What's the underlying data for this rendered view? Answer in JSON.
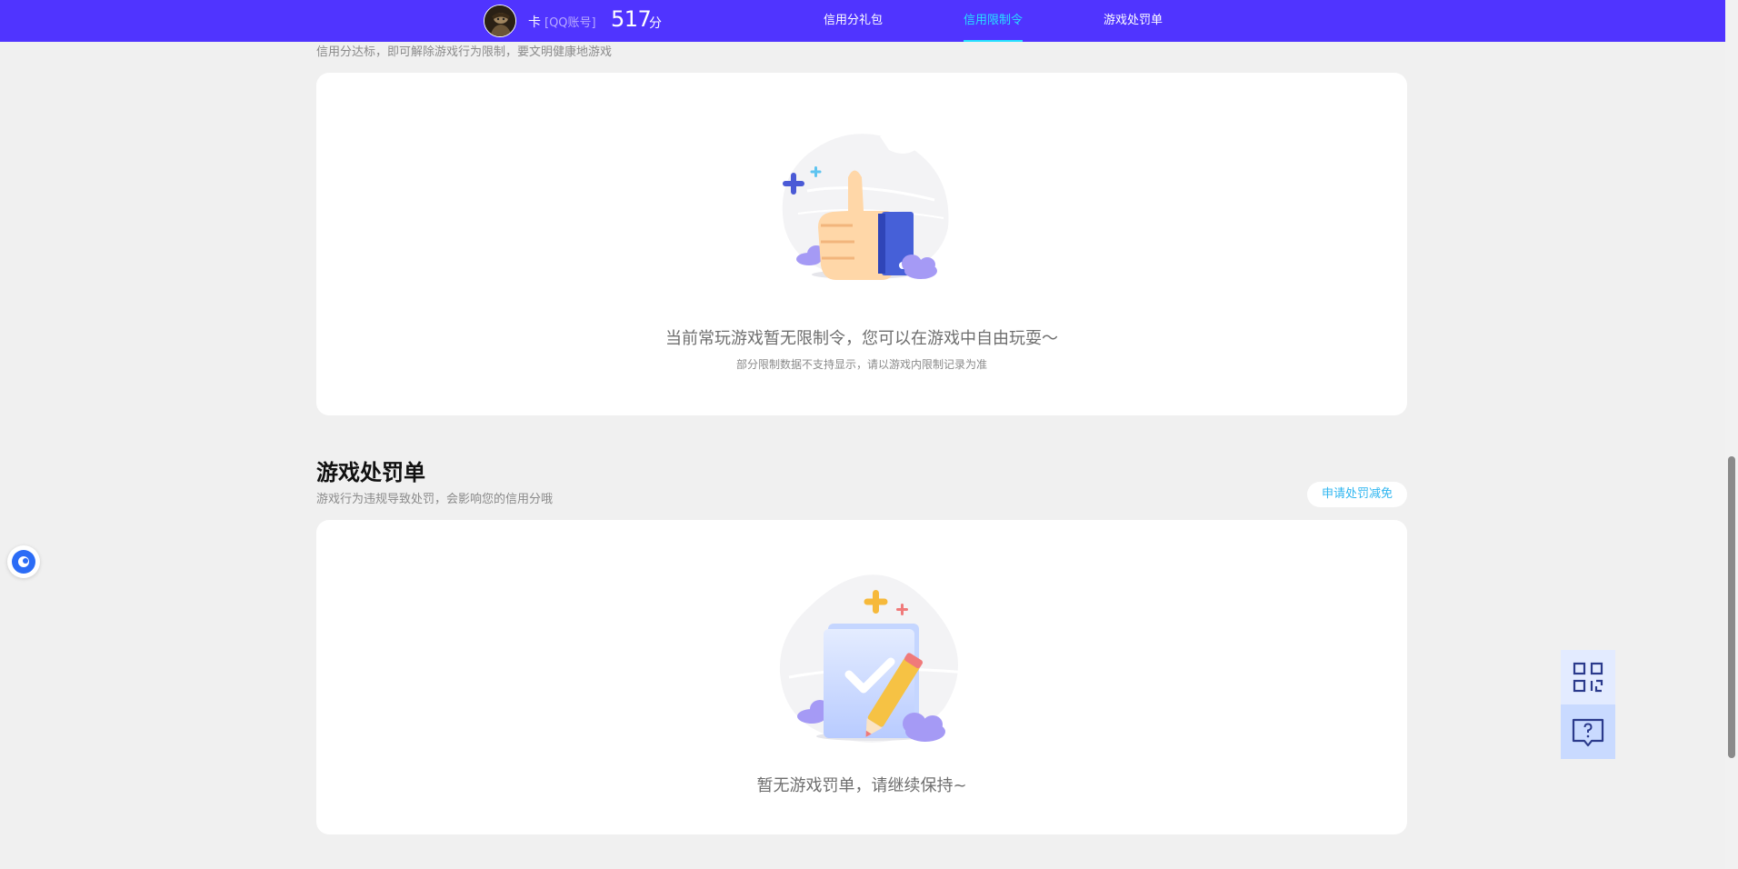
{
  "header": {
    "user_name": "卡",
    "account_type": "[QQ账号]",
    "score": "517",
    "score_unit": "分",
    "tabs": [
      {
        "label": "信用分礼包"
      },
      {
        "label": "信用限制令"
      },
      {
        "label": "游戏处罚单"
      }
    ],
    "accent_color": "#5034ff",
    "active_color": "#27e0ff"
  },
  "restrictions": {
    "subtitle": "信用分达标，即可解除游戏行为限制，要文明健康地游戏",
    "empty_message": "当前常玩游戏暂无限制令，您可以在游戏中自由玩耍～",
    "note": "部分限制数据不支持显示，请以游戏内限制记录为准"
  },
  "penalties": {
    "title": "游戏处罚单",
    "subtitle": "游戏行为违规导致处罚，会影响您的信用分哦",
    "appeal_button": "申请处罚减免",
    "empty_message": "暂无游戏罚单，请继续保持~"
  },
  "icons": {
    "left_float": "assistant-icon",
    "qr": "qr-code-icon",
    "help": "help-chat-icon"
  }
}
